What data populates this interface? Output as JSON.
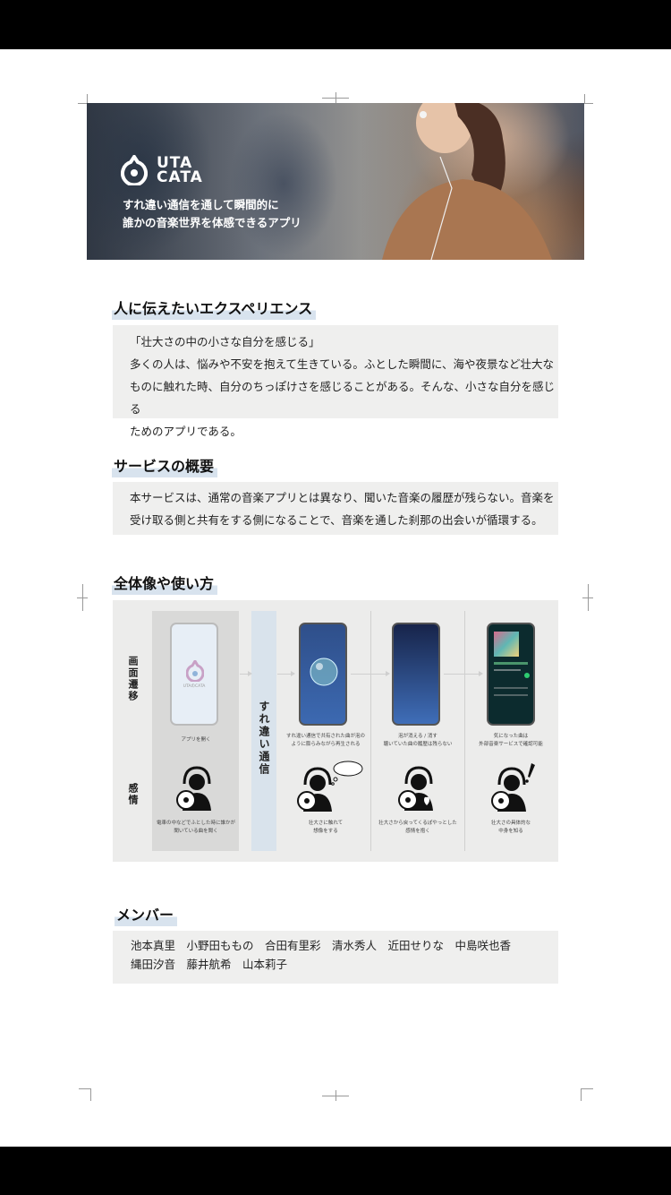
{
  "hero": {
    "logo_line1": "UTA",
    "logo_line2": "CATA",
    "tagline_line1": "すれ違い通信を通して瞬間的に",
    "tagline_line2": "誰かの音楽世界を体感できるアプリ"
  },
  "sections": {
    "experience": {
      "title": "人に伝えたいエクスペリエンス",
      "quote": "「壮大さの中の小さな自分を感じる」",
      "line1": "多くの人は、悩みや不安を抱えて生きている。ふとした瞬間に、海や夜景など壮大な",
      "line2": "ものに触れた時、自分のちっぽけさを感じることがある。そんな、小さな自分を感じる",
      "line3": "ためのアプリである。"
    },
    "overview": {
      "title": "サービスの概要",
      "line1": "本サービスは、通常の音楽アプリとは異なり、聞いた音楽の履歴が残らない。音楽を",
      "line2": "受け取る側と共有をする側になることで、音楽を通した刹那の出会いが循環する。"
    },
    "usage": {
      "title": "全体像や使い方",
      "row_label_screens": "画面遷移",
      "row_label_emotion": "感情",
      "passing_label": "すれ違い通信",
      "app_splash": "UTAのCATA",
      "steps": [
        {
          "caption1": "アプリを開く",
          "caption2": "",
          "emotion1": "電車の中などでふとした時に誰かが",
          "emotion2": "聞いている曲を聞く"
        },
        {
          "caption1": "すれ違い通信で共有された曲が泡の",
          "caption2": "ように膨らみながら再生される",
          "emotion1": "壮大さに触れて",
          "emotion2": "想像をする"
        },
        {
          "caption1": "泡が消える / 消す",
          "caption2": "聴いていた曲の履歴は残らない",
          "emotion1": "壮大さから戻ってくるぽやっとした",
          "emotion2": "感情を抱く"
        },
        {
          "caption1": "気になった曲は",
          "caption2": "外部音楽サービスで確認可能",
          "emotion1": "壮大さの具体的な",
          "emotion2": "中身を知る"
        }
      ]
    },
    "members": {
      "title": "メンバー",
      "line1": "池本真里　小野田ももの　合田有里彩　清水秀人　近田せりな　中島咲也香",
      "line2": "縄田汐音　藤井航希　山本莉子"
    }
  },
  "colors": {
    "title_highlight": "#d8e3ee",
    "box_bg": "#efefee",
    "phone_blue": "#2f4f8a"
  }
}
